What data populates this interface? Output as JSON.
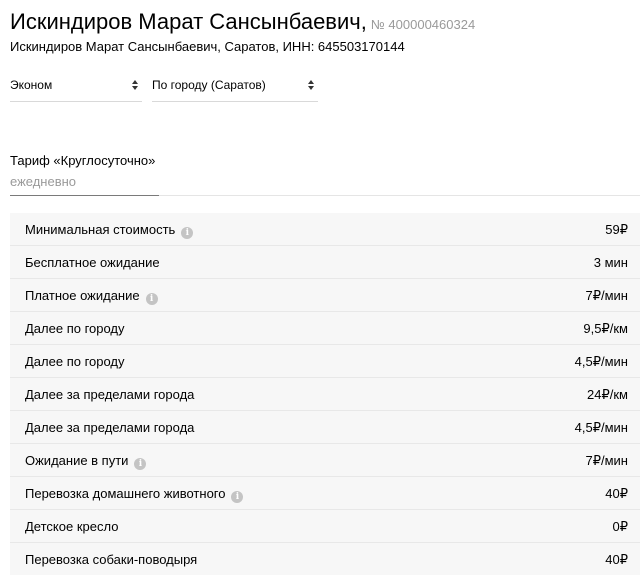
{
  "header": {
    "title": "Искиндиров Марат Сансынбаевич,",
    "reg_number": "№ 400000460324",
    "subtitle": "Искиндиров Марат Сансынбаевич, Саратов, ИНН: 645503170144"
  },
  "filters": {
    "class_value": "Эконом",
    "zone_value": "По городу (Саратов)"
  },
  "tariff": {
    "name": "Тариф «Круглосуточно»",
    "period": "ежедневно"
  },
  "info_icon_glyph": "i",
  "rows": [
    {
      "label": "Минимальная стоимость",
      "value": "59₽",
      "info": true
    },
    {
      "label": "Бесплатное ожидание",
      "value": "3 мин",
      "info": false
    },
    {
      "label": "Платное ожидание",
      "value": "7₽/мин",
      "info": true
    },
    {
      "label": "Далее по городу",
      "value": "9,5₽/км",
      "info": false
    },
    {
      "label": "Далее по городу",
      "value": "4,5₽/мин",
      "info": false
    },
    {
      "label": "Далее за пределами города",
      "value": "24₽/км",
      "info": false
    },
    {
      "label": "Далее за пределами города",
      "value": "4,5₽/мин",
      "info": false
    },
    {
      "label": "Ожидание в пути",
      "value": "7₽/мин",
      "info": true
    },
    {
      "label": "Перевозка домашнего животного",
      "value": "40₽",
      "info": true
    },
    {
      "label": "Детское кресло",
      "value": "0₽",
      "info": false
    },
    {
      "label": "Перевозка собаки-поводыря",
      "value": "40₽",
      "info": false
    }
  ]
}
